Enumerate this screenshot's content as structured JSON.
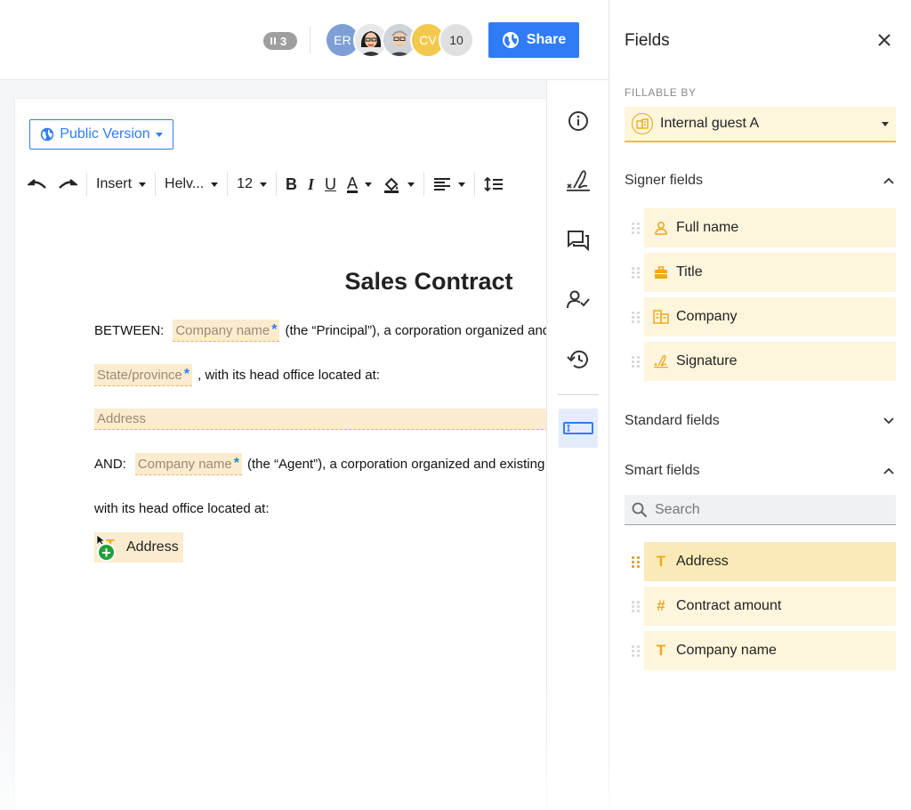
{
  "header": {
    "presence_count": "3",
    "avatars": [
      {
        "initials": "ER"
      },
      {
        "initials": ""
      },
      {
        "initials": ""
      },
      {
        "initials": "CV"
      },
      {
        "initials": "10"
      }
    ],
    "share_label": "Share"
  },
  "document": {
    "version_label": "Public Version",
    "toolbar": {
      "insert": "Insert",
      "font": "Helv...",
      "size": "12"
    },
    "title": "Sales Contract",
    "between_label": "BETWEEN:",
    "company_field": "Company name",
    "principal_text": "(the “Principal”), a corporation organized and",
    "state_field": "State/province",
    "head_office_text": ", with its head office located at:",
    "address_field": "Address",
    "and_label": "AND:",
    "agent_text": "(the “Agent”), a corporation organized and existing u",
    "head_office_text2": "with its head office located at:",
    "dragging_chip": "Address",
    "required_mark": "*"
  },
  "panel": {
    "title": "Fields",
    "fillable_by_label": "FILLABLE BY",
    "fillable_by_value": "Internal guest A",
    "signer_section": "Signer fields",
    "signer_fields": [
      {
        "label": "Full name",
        "icon": "person-icon"
      },
      {
        "label": "Title",
        "icon": "briefcase-icon"
      },
      {
        "label": "Company",
        "icon": "building-icon"
      },
      {
        "label": "Signature",
        "icon": "signature-icon"
      }
    ],
    "standard_section": "Standard fields",
    "smart_section": "Smart fields",
    "search_placeholder": "Search",
    "smart_fields": [
      {
        "label": "Address",
        "glyph": "T"
      },
      {
        "label": "Contract amount",
        "glyph": "#"
      },
      {
        "label": "Company name",
        "glyph": "T"
      }
    ]
  },
  "colors": {
    "accent_blue": "#2f7cf6",
    "field_bg": "#fdf5dc",
    "field_icon": "#f0a81c",
    "active_field": "#faeab7"
  }
}
